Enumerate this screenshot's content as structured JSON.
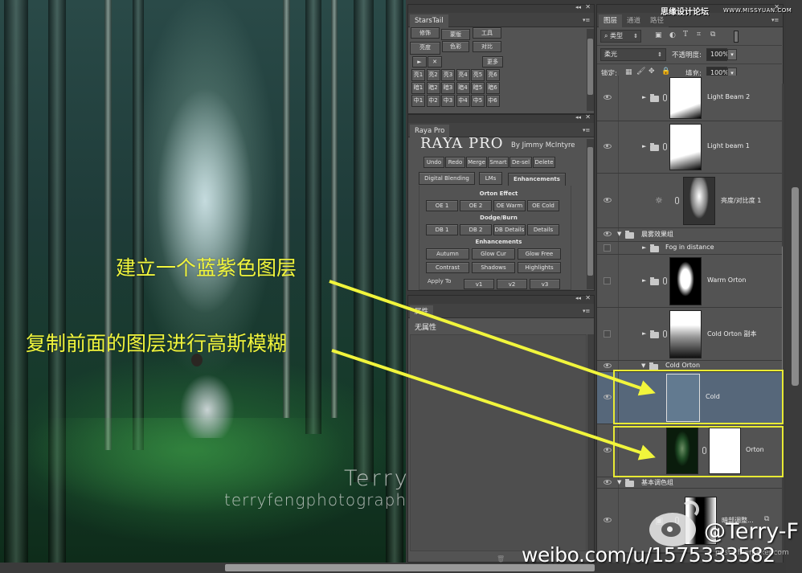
{
  "canvas": {
    "annotations": [
      "建立一个蓝紫色图层",
      "复制前面的图层进行高斯模糊"
    ],
    "watermark_name": "Terry  F",
    "watermark_url": "terryfengphotography.lofter.com"
  },
  "starstail": {
    "tab": "StarsTail",
    "row1": [
      "修饰",
      "蒙版",
      "工具"
    ],
    "row2": [
      "亮度",
      "色彩",
      "对比"
    ],
    "play": "►",
    "stop": "✕",
    "more": "更多",
    "grid": [
      [
        "亮1",
        "亮2",
        "亮3",
        "亮4",
        "亮5",
        "亮6"
      ],
      [
        "暗1",
        "暗2",
        "暗3",
        "暗4",
        "暗5",
        "暗6"
      ],
      [
        "中1",
        "中2",
        "中3",
        "中4",
        "中5",
        "中6"
      ]
    ]
  },
  "raya": {
    "tab": "Raya Pro",
    "title": "RAYA PRO",
    "by": "By Jimmy McIntyre",
    "actions": [
      "Undo",
      "Redo",
      "Merge",
      "Smart",
      "De-sel",
      "Delete"
    ],
    "subtabs": [
      "Digital Blending",
      "LMs",
      "Enhancements"
    ],
    "active_subtab": "Enhancements",
    "orton_label": "Orton Effect",
    "orton": [
      "OE 1",
      "OE 2",
      "OE Warm",
      "OE Cold"
    ],
    "dodge_label": "Dodge/Burn",
    "dodge": [
      "DB 1",
      "DB 2",
      "DB Details",
      "Details"
    ],
    "enh_label": "Enhancements",
    "enh1": [
      "Autumn",
      "Glow Cur",
      "Glow Free"
    ],
    "enh2": [
      "Contrast",
      "Shadows",
      "Highlights"
    ],
    "apply_label": "Apply To",
    "apply": [
      "v1",
      "v2",
      "v3"
    ]
  },
  "properties": {
    "tab": "属性",
    "body": "无属性"
  },
  "layers": {
    "tabs": [
      "图层",
      "通道",
      "路径"
    ],
    "filter_kind": "类型",
    "blend_mode": "柔光",
    "opacity_label": "不透明度:",
    "opacity": "100%",
    "lock_label": "锁定:",
    "fill_label": "填充:",
    "fill": "100%",
    "rows": [
      {
        "name": "Light Beam 2",
        "type": "group",
        "visible": true
      },
      {
        "name": "Light beam 1",
        "type": "group",
        "visible": true
      },
      {
        "name": "亮度/对比度 1",
        "type": "adjustment",
        "visible": true
      },
      {
        "name": "晨雾效果组",
        "type": "group-open",
        "visible": true
      },
      {
        "name": "Fog in distance",
        "type": "group",
        "visible": false
      },
      {
        "name": "Warm Orton",
        "type": "group",
        "visible": false
      },
      {
        "name": "Cold Orton 副本",
        "type": "group",
        "visible": false
      },
      {
        "name": "Cold Orton",
        "type": "group-open",
        "visible": true
      },
      {
        "name": "Cold",
        "type": "fill",
        "visible": true,
        "selected": true,
        "color": "#627a90"
      },
      {
        "name": "Orton",
        "type": "layer-mask",
        "visible": true
      },
      {
        "name": "基本调色组",
        "type": "group-open",
        "visible": true
      },
      {
        "name": "暗部调整...",
        "type": "adjustment",
        "visible": true
      }
    ]
  },
  "overlay": {
    "site_cn": "思缘设计论坛",
    "site_url": "WWW.MISSYUAN.COM",
    "weibo_handle": "@Terry-F",
    "weibo_url": "weibo.com/u/1575333582",
    "credit": "post of uimaker.com"
  },
  "colors": {
    "accent_yellow": "#f1f53c",
    "panel_bg": "#535353",
    "selected_layer": "#56677a"
  }
}
